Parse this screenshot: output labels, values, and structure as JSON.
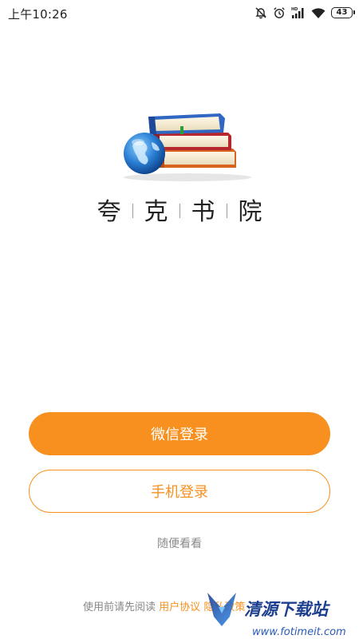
{
  "status_bar": {
    "time": "上午10:26",
    "battery_level": "43",
    "icons": [
      "notifications-off-icon",
      "alarm-icon",
      "hd-signal-icon",
      "wifi-icon",
      "battery-icon"
    ]
  },
  "app": {
    "title_chars": [
      "夸",
      "克",
      "书",
      "院"
    ]
  },
  "buttons": {
    "wechat_login": "微信登录",
    "phone_login": "手机登录",
    "browse": "随便看看"
  },
  "footer": {
    "prefix": "使用前请先阅读",
    "user_agreement": "用户协议",
    "privacy_policy": "隐私政策"
  },
  "watermark": {
    "name": "清源下载站",
    "url": "www.fotimeit.com"
  },
  "colors": {
    "accent": "#f7901e",
    "text": "#222222",
    "muted": "#8a8a8a"
  }
}
